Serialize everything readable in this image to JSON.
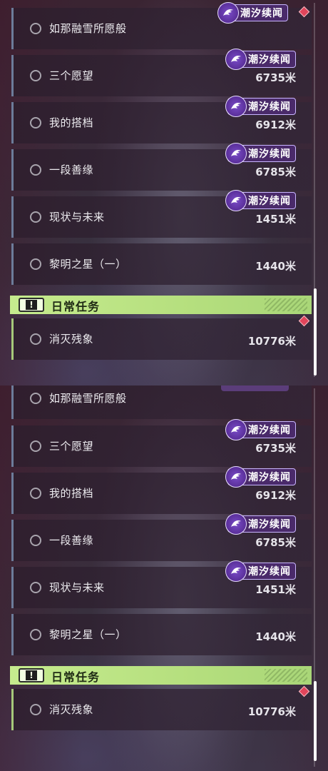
{
  "badge_label": "潮汐续闻",
  "colors": {
    "badge_bg": "#4a2a6a",
    "badge_border": "#c9b6ff",
    "daily_header": "#c6eb8e",
    "diamond": "#e0455b"
  },
  "icons": {
    "badge": "tidal-whispers-emblem-icon",
    "header": "exclamation-icon",
    "radio": "radio-icon",
    "tracked": "diamond-marker-icon"
  },
  "top": {
    "quests": [
      {
        "title": "如那融雪所愿般",
        "distance": ""
      },
      {
        "title": "三个愿望",
        "distance": "6735米"
      },
      {
        "title": "我的搭档",
        "distance": "6912米"
      },
      {
        "title": "一段善缘",
        "distance": "6785米"
      },
      {
        "title": "现状与未来",
        "distance": "1451米"
      },
      {
        "title": "黎明之星（一）",
        "distance": "1440米"
      }
    ],
    "section": {
      "title": "日常任务"
    },
    "daily": [
      {
        "title": "消灭残象",
        "distance": "10776米"
      }
    ]
  },
  "bottom": {
    "quests": [
      {
        "title": "如那融雪所愿般",
        "distance": ""
      },
      {
        "title": "三个愿望",
        "distance": "6735米"
      },
      {
        "title": "我的搭档",
        "distance": "6912米"
      },
      {
        "title": "一段善缘",
        "distance": "6785米"
      },
      {
        "title": "现状与未来",
        "distance": "1451米"
      },
      {
        "title": "黎明之星（一）",
        "distance": "1440米"
      }
    ],
    "section": {
      "title": "日常任务"
    },
    "daily": [
      {
        "title": "消灭残象",
        "distance": "10776米"
      }
    ]
  }
}
